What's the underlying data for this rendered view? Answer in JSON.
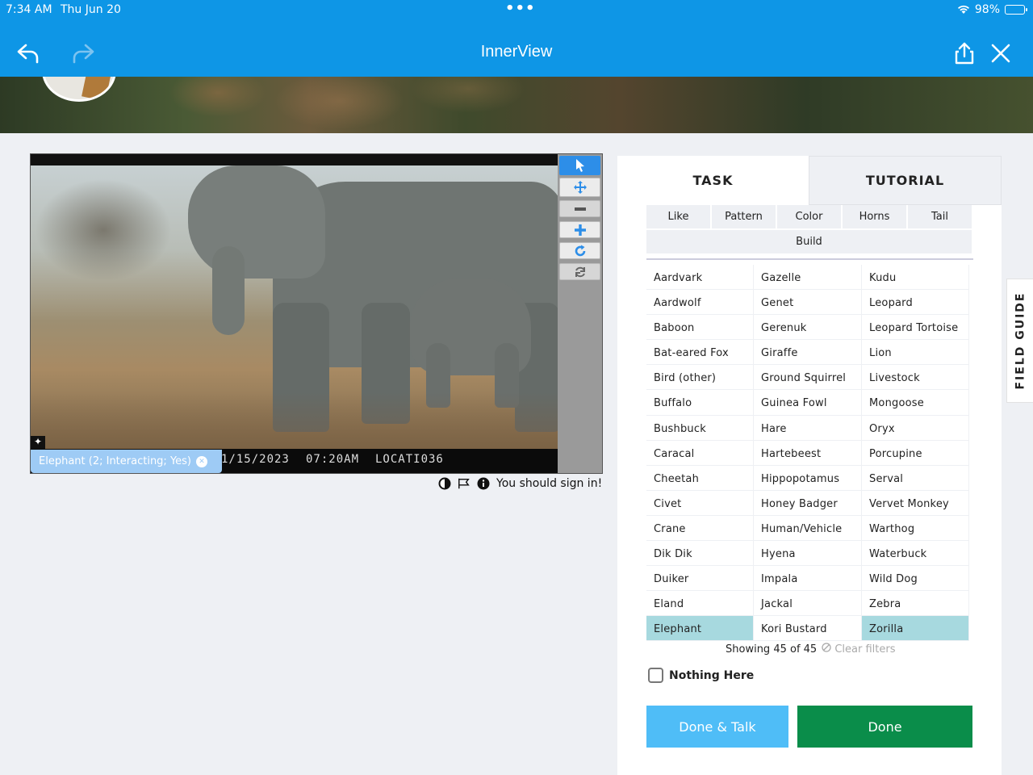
{
  "status_bar": {
    "time": "7:34 AM",
    "date": "Thu Jun 20",
    "dots": "•••",
    "battery": "98%"
  },
  "nav": {
    "title": "InnerView"
  },
  "viewer": {
    "date_stamp": "1/15/2023",
    "time_stamp": "07:20AM",
    "location_stamp": "LOCATI036",
    "annotation_chip": "Elephant (2; Interacting; Yes)",
    "signin_message": "You should sign in!"
  },
  "panel": {
    "tabs": [
      "TASK",
      "TUTORIAL"
    ],
    "filters_row1": [
      "Like",
      "Pattern",
      "Color",
      "Horns",
      "Tail"
    ],
    "filters_row2": [
      "Build"
    ],
    "species": [
      "Aardvark",
      "Gazelle",
      "Kudu",
      "Aardwolf",
      "Genet",
      "Leopard",
      "Baboon",
      "Gerenuk",
      "Leopard Tortoise",
      "Bat-eared Fox",
      "Giraffe",
      "Lion",
      "Bird (other)",
      "Ground Squirrel",
      "Livestock",
      "Buffalo",
      "Guinea Fowl",
      "Mongoose",
      "Bushbuck",
      "Hare",
      "Oryx",
      "Caracal",
      "Hartebeest",
      "Porcupine",
      "Cheetah",
      "Hippopotamus",
      "Serval",
      "Civet",
      "Honey Badger",
      "Vervet Monkey",
      "Crane",
      "Human/Vehicle",
      "Warthog",
      "Dik Dik",
      "Hyena",
      "Waterbuck",
      "Duiker",
      "Impala",
      "Wild Dog",
      "Eland",
      "Jackal",
      "Zebra",
      "Elephant",
      "Kori Bustard",
      "Zorilla"
    ],
    "selected_species": [
      "Elephant",
      "Zorilla"
    ],
    "showing_text": "Showing 45 of 45",
    "clear_filters": "Clear filters",
    "nothing_here": "Nothing Here",
    "done_talk_label": "Done & Talk",
    "done_label": "Done",
    "field_guide_label": "FIELD GUIDE"
  },
  "colors": {
    "nav_bar": "#0e96e6",
    "selected_species": "#a7d9df",
    "done_talk": "#4fbdf7",
    "done": "#0a8d4a",
    "active_tool": "#2d8ee8"
  }
}
